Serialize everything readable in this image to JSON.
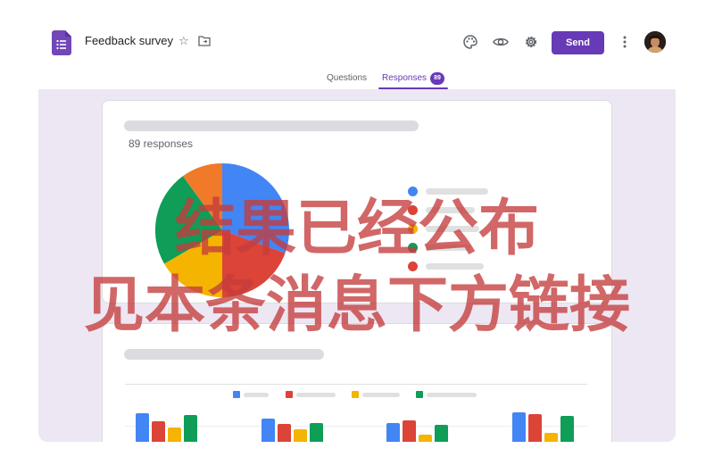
{
  "header": {
    "app_icon": "forms-icon",
    "title": "Feedback survey",
    "star_icon": "star-outline-icon",
    "folder_icon": "move-to-folder-icon",
    "palette_icon": "palette-icon",
    "preview_icon": "eye-icon",
    "settings_icon": "gear-icon",
    "send_label": "Send",
    "more_icon": "more-vert-icon",
    "avatar_icon": "user-avatar"
  },
  "tabs": [
    {
      "label": "Questions",
      "active": false
    },
    {
      "label": "Responses",
      "active": true,
      "badge": "89"
    }
  ],
  "summary_card": {
    "responses_text": "89 responses"
  },
  "overlay": {
    "line1": "结果已经公布",
    "line2": "见本条消息下方链接"
  },
  "colors": {
    "accent": "#673ab7",
    "blue": "#4285f4",
    "red": "#db4437",
    "yellow": "#f4b400",
    "green": "#0f9d58",
    "orange": "#f07a29",
    "background": "#ede7f3"
  }
}
